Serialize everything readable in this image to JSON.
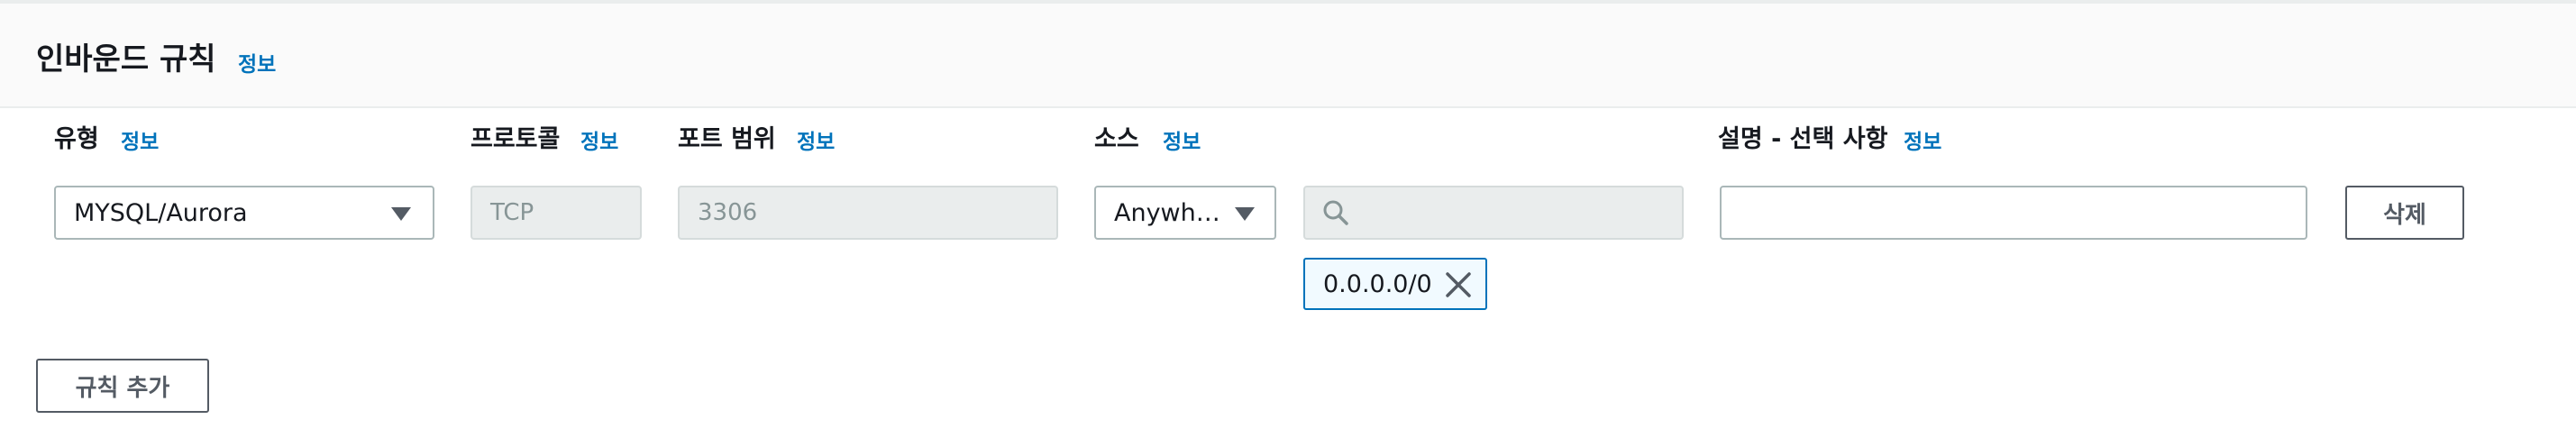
{
  "section": {
    "title": "인바운드 규칙",
    "info": "정보"
  },
  "columns": {
    "type": {
      "label": "유형",
      "info": "정보"
    },
    "protocol": {
      "label": "프로토콜",
      "info": "정보"
    },
    "port_range": {
      "label": "포트 범위",
      "info": "정보"
    },
    "source": {
      "label": "소스",
      "info": "정보"
    },
    "description": {
      "label": "설명 - 선택 사항",
      "info": "정보"
    }
  },
  "rule": {
    "type_value": "MYSQL/Aurora",
    "protocol_value": "TCP",
    "port_value": "3306",
    "source_value": "Anywh…",
    "search_value": "",
    "cidr_token": "0.0.0.0/0",
    "description_value": "",
    "delete_label": "삭제"
  },
  "add_rule_label": "규칙 추가",
  "icons": {
    "search": "search-icon",
    "close": "close-icon",
    "caret": "caret-down-icon"
  }
}
